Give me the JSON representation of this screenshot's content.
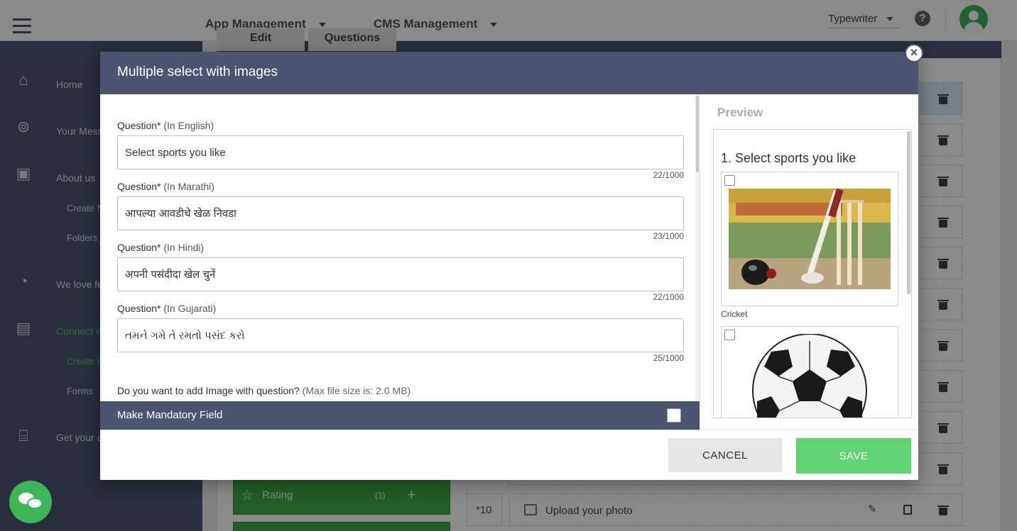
{
  "topbar": {
    "nav_items": [
      "App Management",
      "CMS Management"
    ],
    "workspace": "Typewriter",
    "help": "?"
  },
  "sidebar": {
    "items": [
      {
        "label": "Home",
        "icon": "home-icon"
      },
      {
        "label": "Your Mess",
        "icon": "broadcast-icon"
      },
      {
        "label": "About us",
        "icon": "folder-info-icon"
      },
      {
        "label": "Create N",
        "sub": true
      },
      {
        "label": "Folders",
        "sub": true
      },
      {
        "label": "We love fe",
        "icon": "feedback-icon"
      },
      {
        "label": "Connect w",
        "icon": "document-icon",
        "active": true
      },
      {
        "label": "Create n",
        "sub": true,
        "active": true
      },
      {
        "label": "Forms",
        "sub": true
      },
      {
        "label": "Get your a",
        "icon": "bank-icon"
      }
    ]
  },
  "background": {
    "tabs": [
      "Edit",
      "Questions"
    ],
    "tiles": [
      {
        "label": "Rating",
        "count": "(1)",
        "plus": "+"
      }
    ],
    "row10": {
      "number": "*10",
      "label": "Upload your photo"
    }
  },
  "modal": {
    "title": "Multiple select with images",
    "close": "×",
    "questions": [
      {
        "label": "Question*",
        "lang": "(In English)",
        "value": "Select sports you like",
        "count": "22/1000"
      },
      {
        "label": "Question*",
        "lang": "(In Marathi)",
        "value": "आपल्या आवडीचे खेळ निवडा",
        "count": "23/1000"
      },
      {
        "label": "Question*",
        "lang": "(In Hindi)",
        "value": "अपनी पसंदीदा खेल चुनें",
        "count": "22/1000"
      },
      {
        "label": "Question*",
        "lang": "(In Gujarati)",
        "value": "તમને ગમે તે રમતો પસંદ કરો",
        "count": "25/1000"
      }
    ],
    "image_question": {
      "label": "Do you want to add Image with question?",
      "note": "(Max file size is: 2.0 MB)"
    },
    "mandatory_label": "Make Mandatory Field",
    "preview": {
      "title": "Preview",
      "question": "1. Select sports you like",
      "options": [
        {
          "label": "Cricket",
          "image": "cricket-image"
        },
        {
          "label": "",
          "image": "football-image"
        }
      ]
    },
    "cancel_label": "CANCEL",
    "save_label": "SAVE"
  },
  "colors": {
    "header": "#4c5570",
    "accent_green": "#3fb55a",
    "save_green": "#63d272"
  }
}
